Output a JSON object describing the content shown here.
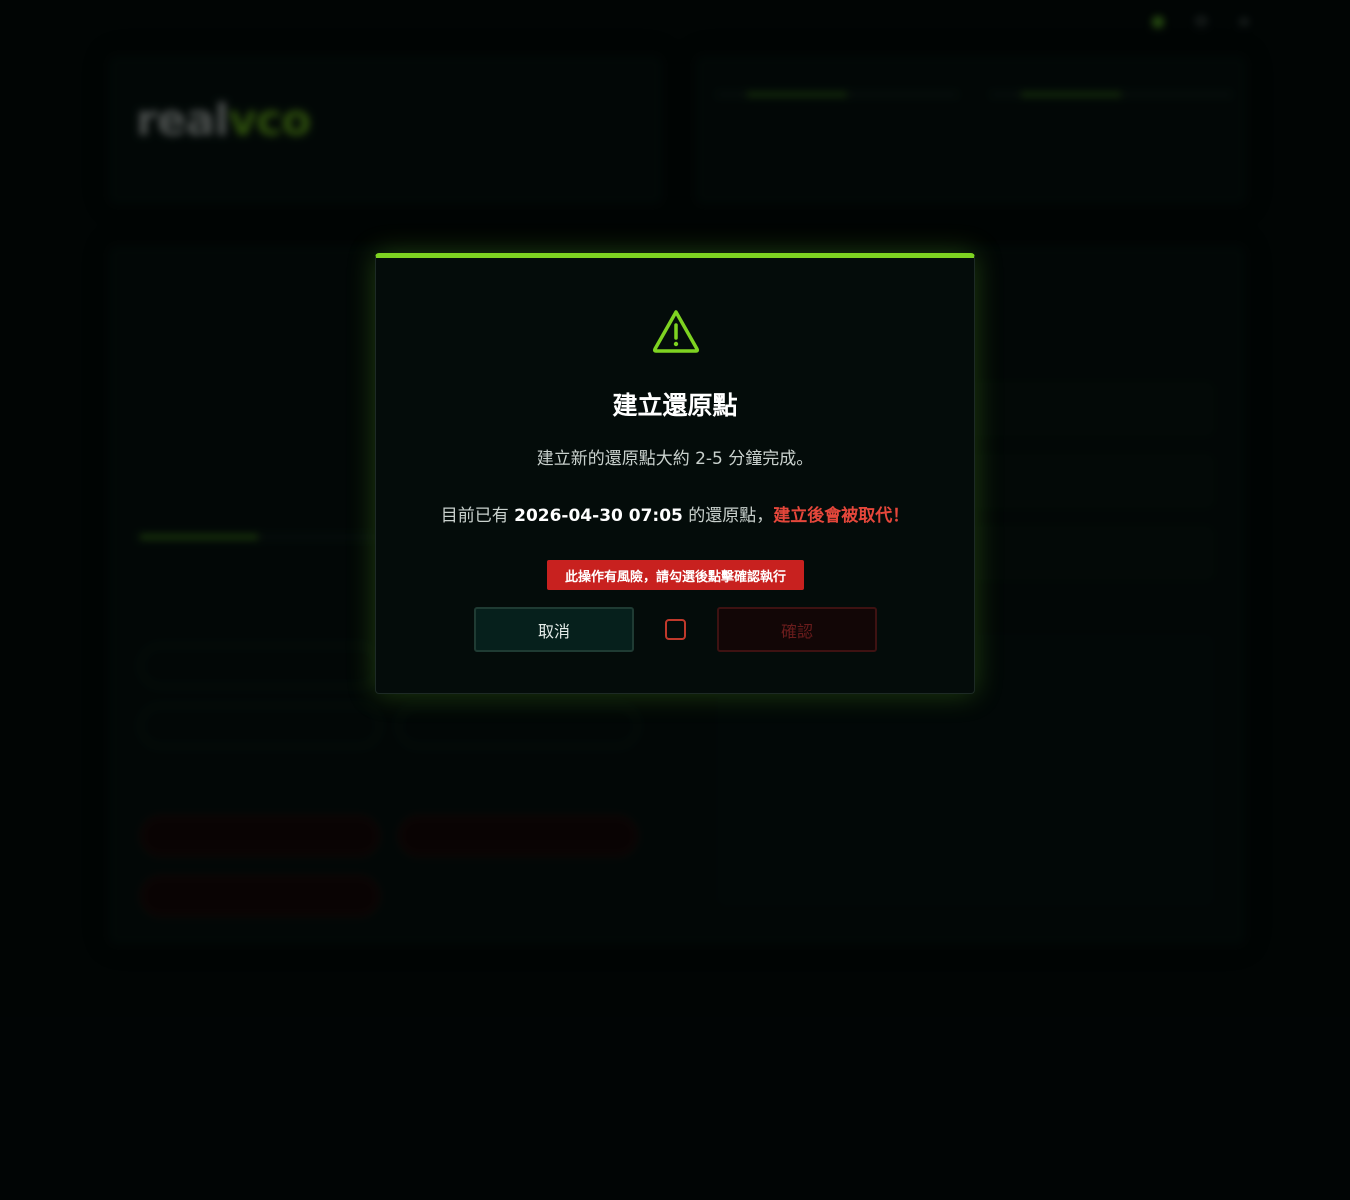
{
  "modal": {
    "title": "建立還原點",
    "description": "建立新的還原點大約 2-5 分鐘完成。",
    "current_prefix": "目前已有 ",
    "current_time": "2026-04-30 07:05",
    "current_suffix": " 的還原點，",
    "current_warning": "建立後會被取代！",
    "risk_notice": "此操作有風險，請勾選後點擊確認執行",
    "cancel_label": "取消",
    "confirm_label": "確認",
    "confirm_checked": false,
    "accent_color": "#7ed321",
    "danger_color": "#e5473b",
    "icon": "warning-triangle-icon"
  }
}
